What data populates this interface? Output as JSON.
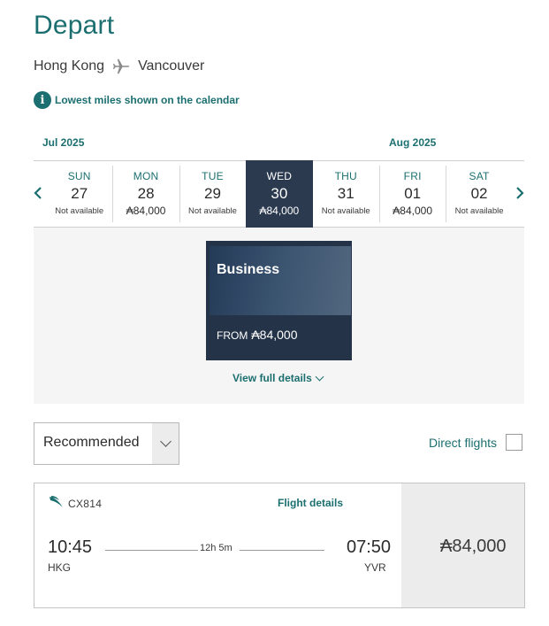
{
  "header": {
    "title": "Depart",
    "origin": "Hong Kong",
    "destination": "Vancouver"
  },
  "info": {
    "icon": "info-icon",
    "text": "Lowest miles shown on the calendar"
  },
  "calendar": {
    "months": [
      "Jul 2025",
      "Aug 2025"
    ],
    "days": [
      {
        "dow": "SUN",
        "date": "27",
        "value": "Not available",
        "available": false,
        "selected": false
      },
      {
        "dow": "MON",
        "date": "28",
        "value": "₳84,000",
        "available": true,
        "selected": false
      },
      {
        "dow": "TUE",
        "date": "29",
        "value": "Not available",
        "available": false,
        "selected": false
      },
      {
        "dow": "WED",
        "date": "30",
        "value": "₳84,000",
        "available": true,
        "selected": true
      },
      {
        "dow": "THU",
        "date": "31",
        "value": "Not available",
        "available": false,
        "selected": false
      },
      {
        "dow": "FRI",
        "date": "01",
        "value": "₳84,000",
        "available": true,
        "selected": false
      },
      {
        "dow": "SAT",
        "date": "02",
        "value": "Not available",
        "available": false,
        "selected": false
      }
    ]
  },
  "fare_card": {
    "cabin": "Business",
    "from_label": "FROM",
    "price": "₳84,000"
  },
  "view_details": "View full details",
  "sort": {
    "selected": "Recommended"
  },
  "filter": {
    "direct_label": "Direct flights",
    "checked": false
  },
  "flight": {
    "number": "CX814",
    "details_link": "Flight details",
    "dep_time": "10:45",
    "dep_code": "HKG",
    "arr_time": "07:50",
    "arr_code": "YVR",
    "duration": "12h 5m",
    "price": "₳84,000"
  },
  "colors": {
    "accent": "#1c6f70",
    "selected_day": "#2b3a4f",
    "card": "#243347"
  }
}
